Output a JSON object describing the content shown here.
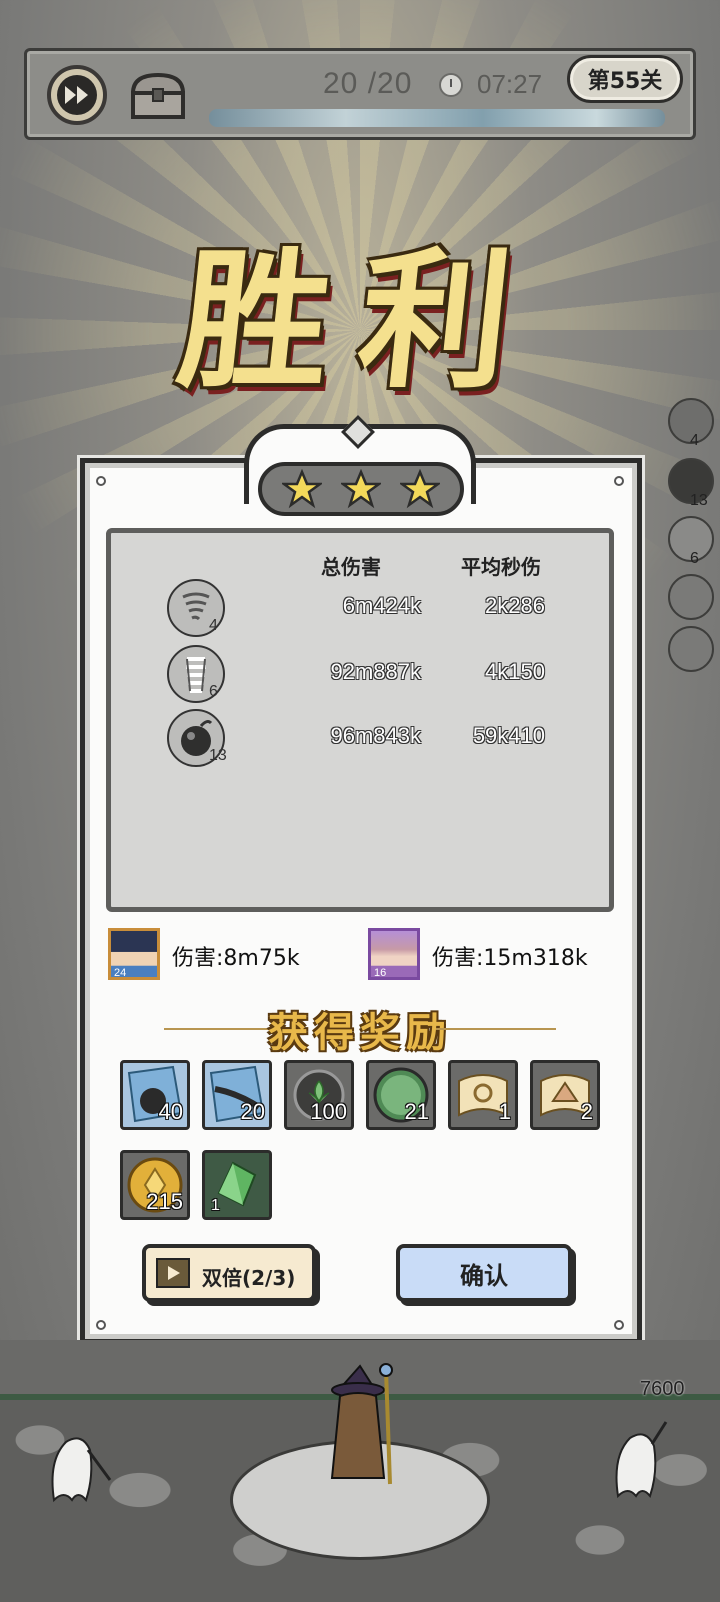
{
  "topbar": {
    "counter": "20 /20",
    "timer": "07:27",
    "level": "第55关"
  },
  "victory_title": "胜利",
  "side_skills": [
    {
      "count": "4"
    },
    {
      "count": "13"
    },
    {
      "count": "6"
    }
  ],
  "stats": {
    "header_total": "总伤害",
    "header_dps": "平均秒伤",
    "rows": [
      {
        "icon": "tornado-icon",
        "level": "4",
        "total": "6m424k",
        "dps": "2k286"
      },
      {
        "icon": "whirlwind-icon",
        "level": "6",
        "total": "92m887k",
        "dps": "4k150"
      },
      {
        "icon": "bomb-icon",
        "level": "13",
        "total": "96m843k",
        "dps": "59k410"
      }
    ]
  },
  "heroes": [
    {
      "level": "24",
      "damage": "伤害:8m75k"
    },
    {
      "level": "16",
      "damage": "伤害:15m318k"
    }
  ],
  "rewards_title": "获得奖励",
  "rewards": [
    {
      "icon": "bomb-crystal-icon",
      "count": "40"
    },
    {
      "icon": "blade-crystal-icon",
      "count": "20"
    },
    {
      "icon": "leaf-emblem-icon",
      "count": "100"
    },
    {
      "icon": "exp-orb-icon",
      "count": "21"
    },
    {
      "icon": "scroll-ring-icon",
      "count": "1"
    },
    {
      "icon": "scroll-shell-icon",
      "count": "2"
    },
    {
      "icon": "gold-coin-icon",
      "count": "215"
    },
    {
      "icon": "green-gem-icon",
      "count": "1"
    }
  ],
  "buttons": {
    "double": "双倍(2/3)",
    "confirm": "确认"
  },
  "base_hp": "7600",
  "colors": {
    "gold_text": "#f4e08e",
    "confirm_bg": "#c9dcf7",
    "double_bg": "#f6ead0"
  }
}
